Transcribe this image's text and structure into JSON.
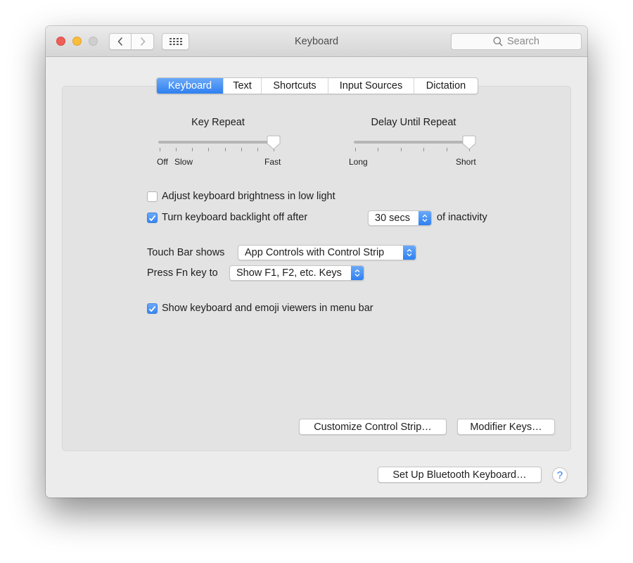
{
  "window": {
    "title": "Keyboard",
    "search_placeholder": "Search",
    "traffic_lights": {
      "close": "#ee5f58",
      "minimize": "#f8bd3a",
      "zoom": "#cfcfcf"
    }
  },
  "tabs": [
    {
      "label": "Keyboard",
      "active": true
    },
    {
      "label": "Text",
      "active": false
    },
    {
      "label": "Shortcuts",
      "active": false
    },
    {
      "label": "Input Sources",
      "active": false
    },
    {
      "label": "Dictation",
      "active": false
    }
  ],
  "sliders": {
    "key_repeat": {
      "title": "Key Repeat",
      "labels": {
        "off": "Off",
        "slow": "Slow",
        "fast": "Fast"
      },
      "ticks": 8,
      "value_fraction": 1.0
    },
    "delay_until_repeat": {
      "title": "Delay Until Repeat",
      "labels": {
        "long": "Long",
        "short": "Short"
      },
      "ticks": 6,
      "value_fraction": 1.0
    }
  },
  "options": {
    "adjust_brightness": {
      "label": "Adjust keyboard brightness in low light",
      "checked": false
    },
    "backlight_off": {
      "label": "Turn keyboard backlight off after",
      "checked": true,
      "popup_value": "30 secs",
      "suffix": "of inactivity"
    },
    "touch_bar": {
      "label": "Touch Bar shows",
      "value": "App Controls with Control Strip"
    },
    "fn_key": {
      "label": "Press Fn key to",
      "value": "Show F1, F2, etc. Keys"
    },
    "show_viewers": {
      "label": "Show keyboard and emoji viewers in menu bar",
      "checked": true
    }
  },
  "buttons": {
    "customize_control_strip": "Customize Control Strip…",
    "modifier_keys": "Modifier Keys…",
    "setup_bluetooth": "Set Up Bluetooth Keyboard…",
    "help": "?"
  },
  "colors": {
    "accent": "#3a86f1",
    "panel": "#e3e3e3",
    "window": "#ececec"
  }
}
